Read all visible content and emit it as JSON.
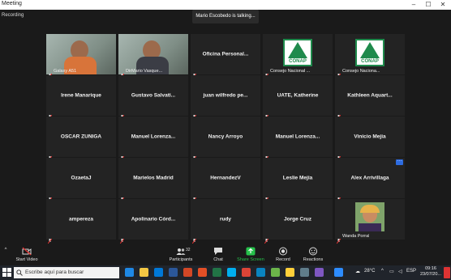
{
  "window": {
    "title": "Meeting",
    "recording": "Recording"
  },
  "status": {
    "talking": "Mario Escobedo is talking..."
  },
  "participants": [
    {
      "kind": "video",
      "label": "Galaxy A51"
    },
    {
      "kind": "video",
      "label": "DirMario Vasque..."
    },
    {
      "kind": "name",
      "name": "Oficina  Personal..."
    },
    {
      "kind": "logo",
      "label": "Consejo Nacional ...",
      "logo_text": "CONAP"
    },
    {
      "kind": "logo",
      "label": "Consejo Naciona...",
      "logo_text": "CONAP"
    },
    {
      "kind": "name",
      "name": "Irene Manarique"
    },
    {
      "kind": "name",
      "name": "Gustavo  Salvati..."
    },
    {
      "kind": "name",
      "name": "juan wilfredo  pe..."
    },
    {
      "kind": "name",
      "name": "UATE, Katherine"
    },
    {
      "kind": "name",
      "name": "Kathleen  Aquart..."
    },
    {
      "kind": "name",
      "name": "OSCAR ZUÑIGA"
    },
    {
      "kind": "name",
      "name": "Manuel  Lorenza..."
    },
    {
      "kind": "name",
      "name": "Nancy Arroyo"
    },
    {
      "kind": "name",
      "name": "Manuel  Lorenza..."
    },
    {
      "kind": "name",
      "name": "Vinicio Mejia"
    },
    {
      "kind": "name",
      "name": "OzaetaJ"
    },
    {
      "kind": "name",
      "name": "Marielos Madrid"
    },
    {
      "kind": "name",
      "name": "HernandezV"
    },
    {
      "kind": "name",
      "name": "Leslie Mejia"
    },
    {
      "kind": "name",
      "name": "Alex Arrivillaga",
      "more_menu": "···"
    },
    {
      "kind": "name",
      "name": "ampereza"
    },
    {
      "kind": "name",
      "name": "Apolinario  Córd..."
    },
    {
      "kind": "name",
      "name": "rudy"
    },
    {
      "kind": "name",
      "name": "Jorge Cruz"
    },
    {
      "kind": "photo",
      "label": "Wanda Porral"
    }
  ],
  "toolbar": {
    "start_video": "Start Video",
    "participants": "Participants",
    "participants_count": "32",
    "chat": "Chat",
    "share_screen": "Share Screen",
    "record": "Record",
    "reactions": "Reactions"
  },
  "taskbar": {
    "search_placeholder": "Escribe aquí para buscar",
    "temperature": "28°C",
    "language": "ESP",
    "time": "09:16",
    "date": "23/07/20..."
  },
  "colors": {
    "share_green": "#26c24b",
    "mic_red": "#e0312f",
    "conap_green": "#1f8a4c",
    "more_blue": "#2d6be0"
  }
}
